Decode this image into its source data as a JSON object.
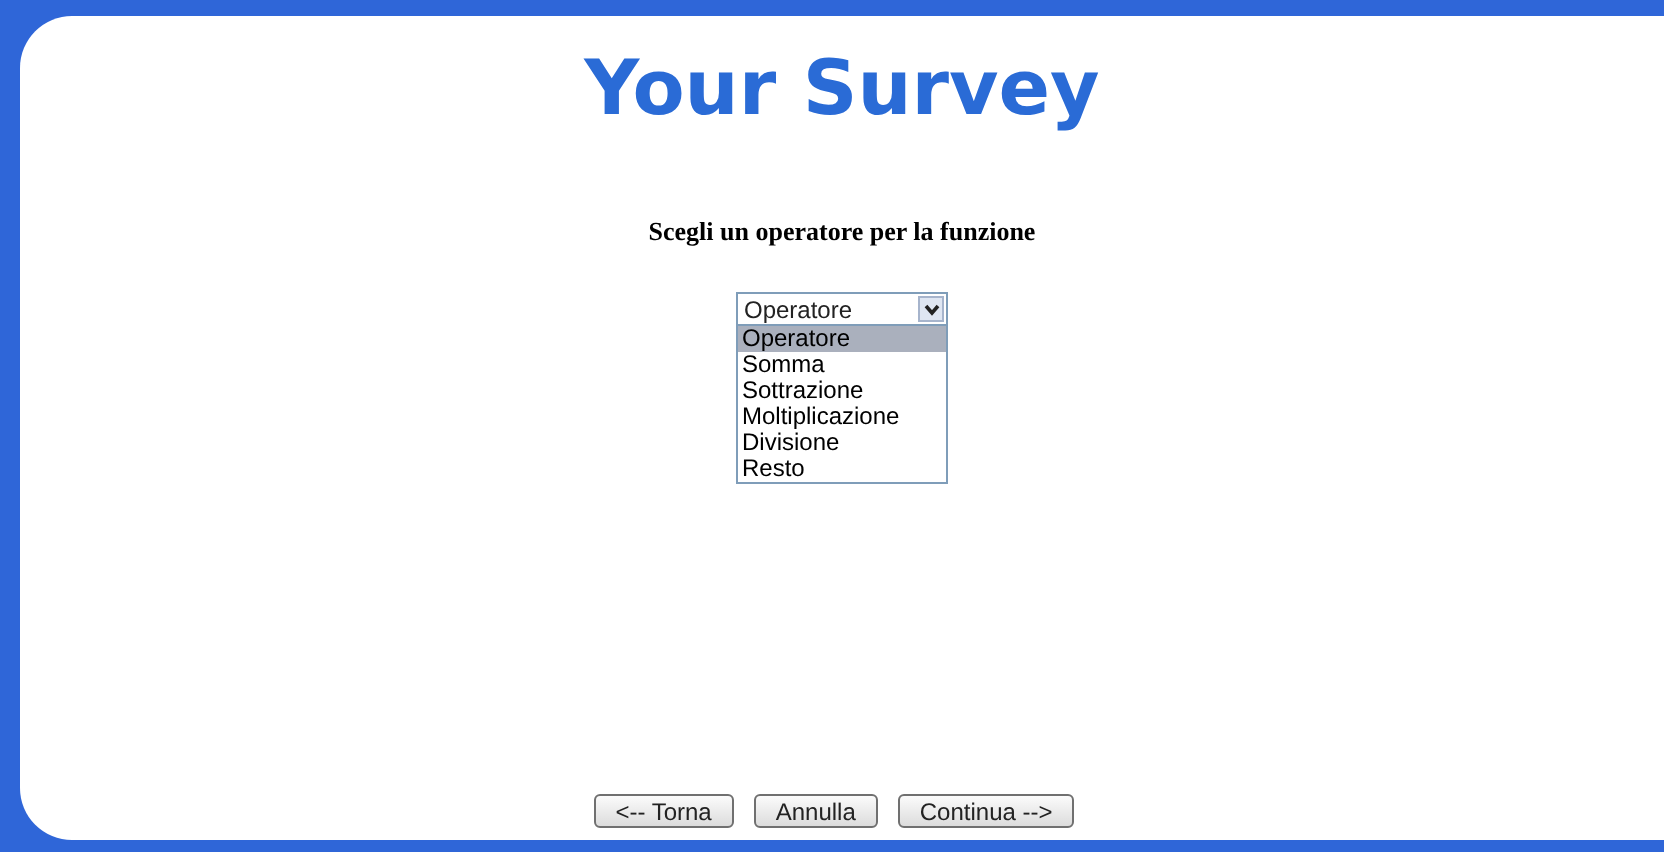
{
  "title": "Your Survey",
  "prompt": "Scegli un operatore per la funzione",
  "select": {
    "value": "Operatore",
    "expanded": true,
    "options": [
      {
        "label": "Operatore",
        "selected": true
      },
      {
        "label": "Somma",
        "selected": false
      },
      {
        "label": "Sottrazione",
        "selected": false
      },
      {
        "label": "Moltiplicazione",
        "selected": false
      },
      {
        "label": "Divisione",
        "selected": false
      },
      {
        "label": "Resto",
        "selected": false
      }
    ]
  },
  "buttons": [
    "<-- Torna",
    "Annulla",
    "Continua -->"
  ]
}
